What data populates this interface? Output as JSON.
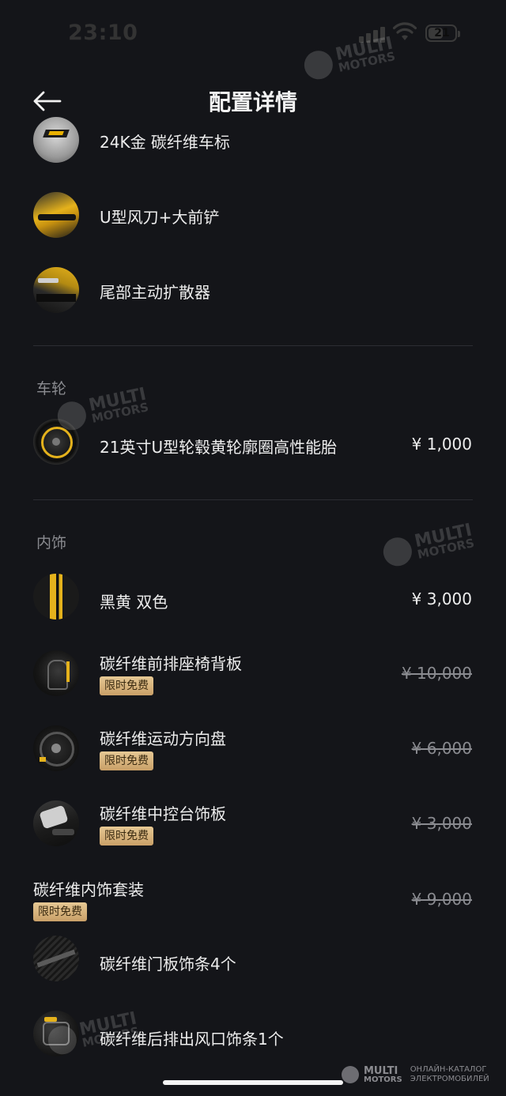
{
  "status_bar": {
    "time": "23:10",
    "battery": "21"
  },
  "nav": {
    "title": "配置详情"
  },
  "items_top": [
    {
      "label": "24K金 碳纤维车标"
    },
    {
      "label": "U型风刀+大前铲"
    },
    {
      "label": "尾部主动扩散器"
    }
  ],
  "sections": {
    "wheels": {
      "title": "车轮",
      "items": [
        {
          "label": "21英寸U型轮毂黄轮廓圈高性能胎",
          "price": "¥ 1,000"
        }
      ]
    },
    "interior": {
      "title": "内饰",
      "items": [
        {
          "label": "黑黄 双色",
          "price": "¥ 3,000"
        },
        {
          "label": "碳纤维前排座椅背板",
          "badge": "限时免费",
          "price": "¥ 10,000"
        },
        {
          "label": "碳纤维运动方向盘",
          "badge": "限时免费",
          "price": "¥ 6,000"
        },
        {
          "label": "碳纤维中控台饰板",
          "badge": "限时免费",
          "price": "¥ 3,000"
        }
      ],
      "package": {
        "label": "碳纤维内饰套装",
        "badge": "限时免费",
        "price": "¥ 9,000",
        "items": [
          {
            "label": "碳纤维门板饰条4个"
          },
          {
            "label": "碳纤维后排出风口饰条1个"
          }
        ]
      }
    }
  },
  "watermark": {
    "line1": "MULTI",
    "line2": "MOTORS"
  },
  "footer": {
    "brand_line1": "MULTI",
    "brand_line2": "MOTORS",
    "tagline_1": "ОНЛАЙН-КАТАЛОГ",
    "tagline_2": "ЭЛЕКТРОМОБИЛЕЙ"
  },
  "colors": {
    "background": "#141519",
    "text": "#EDEDED",
    "muted": "#8A8B90",
    "badge_gold": "#D8B27A",
    "accent_yellow": "#E8B000"
  }
}
